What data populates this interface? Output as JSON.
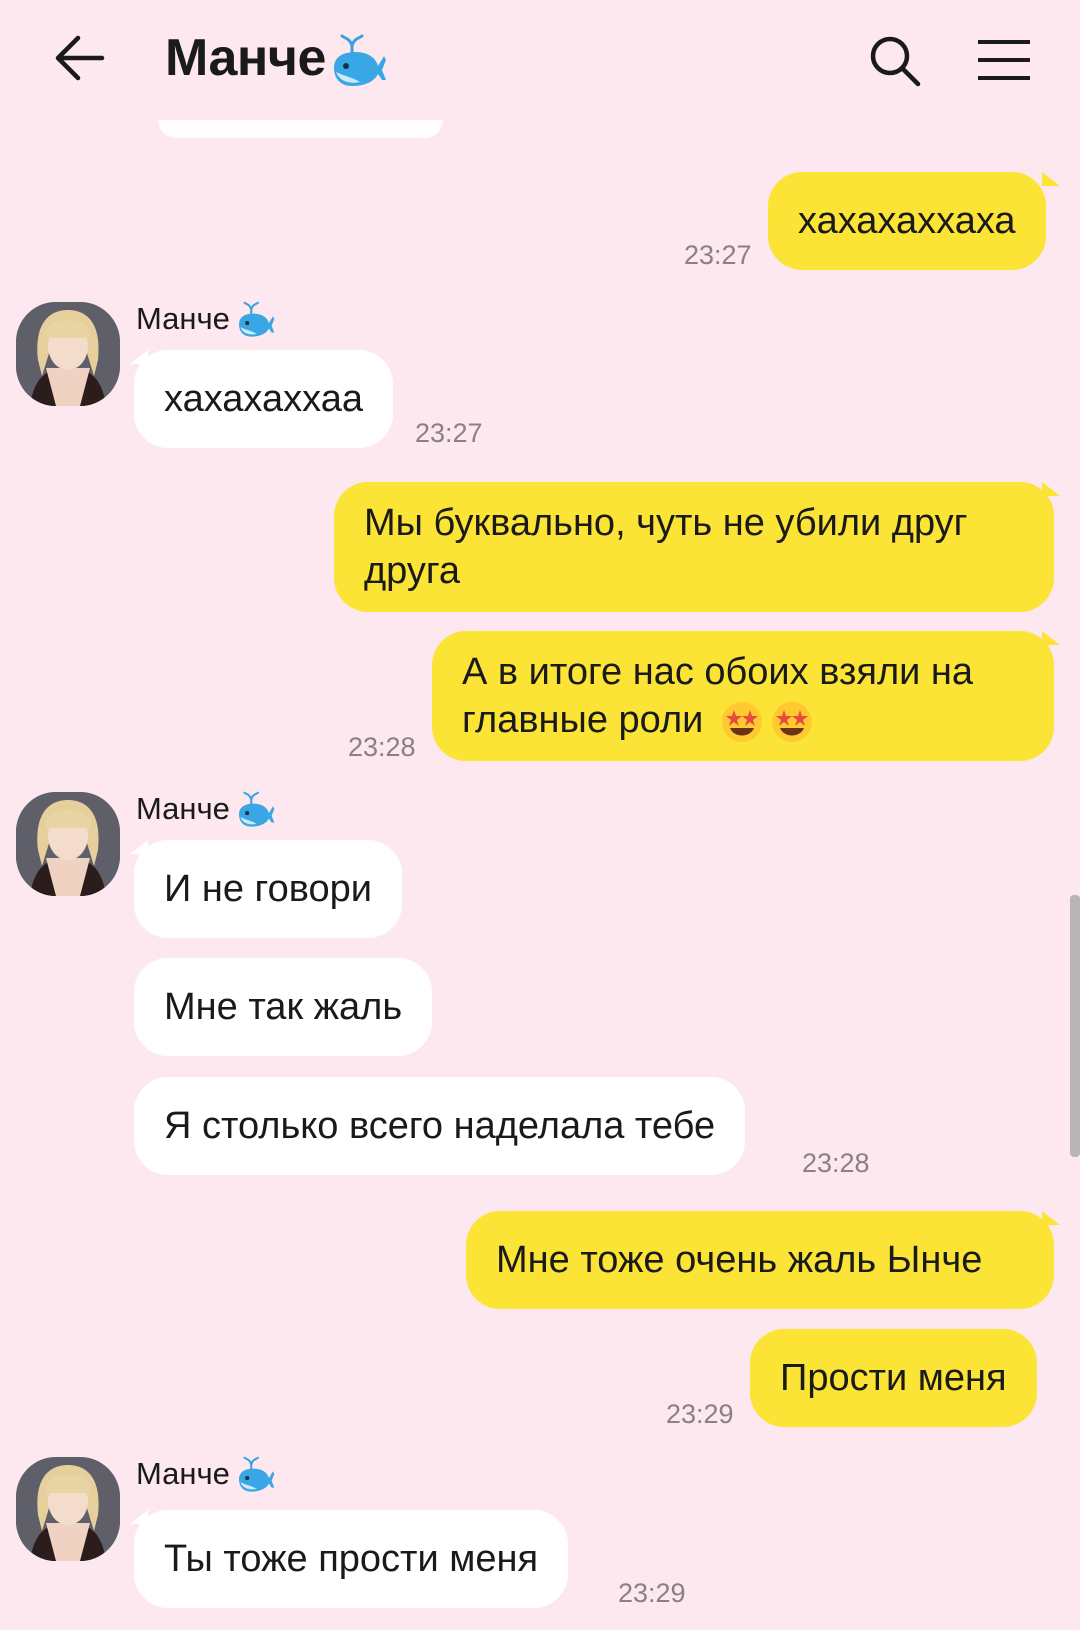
{
  "header": {
    "title": "Манче",
    "title_emoji": "whale-emoji",
    "back_icon": "arrow-left-icon",
    "search_icon": "search-icon",
    "menu_icon": "menu-icon"
  },
  "colors": {
    "background": "#fce8ee",
    "outgoing_bubble": "#fbe435",
    "incoming_bubble": "#ffffff",
    "time_text": "#8a8085"
  },
  "messages": [
    {
      "dir": "out",
      "text": "хахахаххаха",
      "time": "23:27"
    },
    {
      "dir": "in",
      "sender": "Манче",
      "text": "хахахаххаа",
      "time": "23:27"
    },
    {
      "dir": "out",
      "text": "Мы буквально, чуть не убили друг друга"
    },
    {
      "dir": "out",
      "text": "А в итоге нас обоих взяли на главные роли",
      "emoji": "star-struck-emoji",
      "time": "23:28"
    },
    {
      "dir": "in",
      "sender": "Манче",
      "text": "И не говори"
    },
    {
      "dir": "in",
      "text": "Мне так жаль"
    },
    {
      "dir": "in",
      "text": "Я столько всего наделала тебе",
      "time": "23:28"
    },
    {
      "dir": "out",
      "text": "Мне тоже очень жаль Ынче"
    },
    {
      "dir": "out",
      "text": "Прости меня",
      "time": "23:29"
    },
    {
      "dir": "in",
      "sender": "Манче",
      "text": "Ты тоже прости меня",
      "time": "23:29"
    }
  ]
}
